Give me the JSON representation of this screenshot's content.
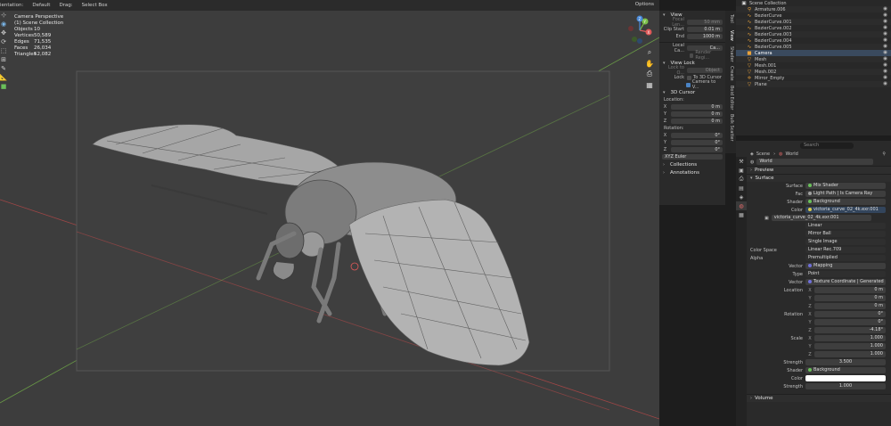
{
  "topbar": {
    "items": [
      "ientation:",
      "Default",
      "Drag:",
      "Select Box"
    ],
    "options": "Options"
  },
  "viewport": {
    "info": {
      "title": "Camera Perspective",
      "collection": "(1) Scene Collection",
      "stats": [
        {
          "label": "Objects",
          "value": "10"
        },
        {
          "label": "Vertices",
          "value": "50,589"
        },
        {
          "label": "Edges",
          "value": "71,535"
        },
        {
          "label": "Faces",
          "value": "26,034"
        },
        {
          "label": "Triangles",
          "value": "52,082"
        }
      ]
    },
    "gizmo_labels": {
      "x": "X",
      "y": "Y",
      "z": "Z"
    }
  },
  "npanel": {
    "view_head": "View",
    "focal_label": "Focal Len...",
    "focal_value": "50 mm",
    "clip_start_label": "Clip Start",
    "clip_start_value": "0.01 m",
    "end_label": "End",
    "end_value": "1000 m",
    "local_cam_label": "Local Ca...",
    "local_cam_value": "Ca...",
    "render_region": "Render Regi...",
    "view_lock_head": "View Lock",
    "lock_obj_label": "Lock to O...",
    "lock_obj_value": "Object",
    "lock_label": "Lock",
    "to_3d_cursor": "To 3D Cursor",
    "camera_to_view": "Camera to V...",
    "cursor_head": "3D Cursor",
    "location_label": "Location:",
    "loc": [
      {
        "axis": "X",
        "value": "0 m"
      },
      {
        "axis": "Y",
        "value": "0 m"
      },
      {
        "axis": "Z",
        "value": "0 m"
      }
    ],
    "rotation_label": "Rotation:",
    "rot": [
      {
        "axis": "X",
        "value": "0°"
      },
      {
        "axis": "Y",
        "value": "0°"
      },
      {
        "axis": "Z",
        "value": "0°"
      }
    ],
    "euler": "XYZ Euler",
    "collections_head": "Collections",
    "annotations_head": "Annotations"
  },
  "sidetabs": [
    "Tool",
    "View",
    "Shader",
    "Create",
    "Boid Editor",
    "Bulk Scatter"
  ],
  "outliner": {
    "title": "Scene Collection",
    "items": [
      "Armature.006",
      "BezierCurve",
      "BezierCurve.001",
      "BezierCurve.002",
      "BezierCurve.003",
      "BezierCurve.004",
      "BezierCurve.005",
      "Camera",
      "Mesh",
      "Mesh.001",
      "Mesh.002",
      "Mirror_Empty",
      "Plane"
    ]
  },
  "properties": {
    "search_placeholder": "Search",
    "breadcrumb_scene": "Scene",
    "breadcrumb_world": "World",
    "world_name": "World",
    "preview_head": "Preview",
    "surface_head": "Surface",
    "surface_label": "Surface",
    "surface_value": "Mix Shader",
    "fac_label": "Fac",
    "fac_value": "Light Path | Is Camera Ray",
    "shader_label": "Shader",
    "shader_value": "Background",
    "color_label": "Color",
    "color_value": "victoria_curve_02_4k.exr.001",
    "image_name": "victoria_curve_02_4k.exr.001",
    "interp": "Linear",
    "projection": "Mirror Ball",
    "source": "Single Image",
    "color_space_label": "Color Space",
    "color_space_value": "Linear Rec.709",
    "alpha_label": "Alpha",
    "alpha_value": "Premultiplied",
    "vector_label": "Vector",
    "vector_value": "Mapping",
    "type_label": "Type",
    "type_value": "Point",
    "vector2_label": "Vector",
    "vector2_value": "Texture Coordinate | Generated",
    "location_label": "Location",
    "location": [
      {
        "axis": "X",
        "value": "0 m"
      },
      {
        "axis": "Y",
        "value": "0 m"
      },
      {
        "axis": "Z",
        "value": "0 m"
      }
    ],
    "rotation_label": "Rotation",
    "rotation": [
      {
        "axis": "X",
        "value": "0°"
      },
      {
        "axis": "Y",
        "value": "0°"
      },
      {
        "axis": "Z",
        "value": "-4.18°"
      }
    ],
    "scale_label": "Scale",
    "scale": [
      {
        "axis": "X",
        "value": "1.000"
      },
      {
        "axis": "Y",
        "value": "1.000"
      },
      {
        "axis": "Z",
        "value": "1.000"
      }
    ],
    "strength_label": "Strength",
    "strength_value": "3.500",
    "shader2_label": "Shader",
    "shader2_value": "Background",
    "color2_label": "Color",
    "strength2_label": "Strength",
    "strength2_value": "1.000",
    "volume_head": "Volume"
  },
  "colors": {
    "accent": "#4a83c4",
    "red_axis": "#e05a5a",
    "green_axis": "#7bbf4a",
    "blue_axis": "#4a8ad8",
    "orange_icon": "#e8a13a"
  }
}
